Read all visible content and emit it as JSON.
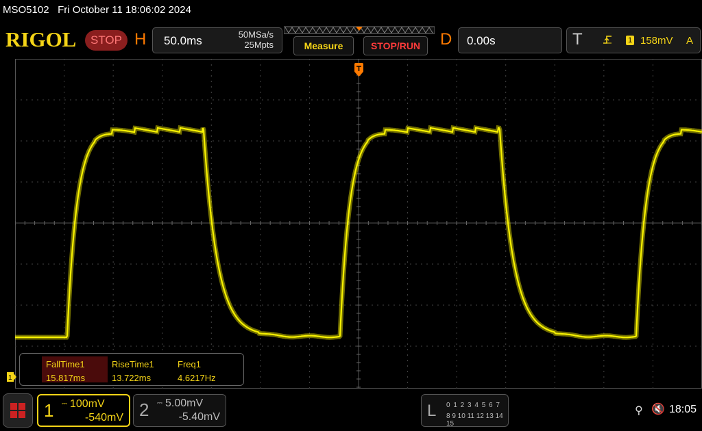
{
  "title_bar": {
    "model": "MSO5102",
    "datetime": "Fri October 11 18:06:02 2024"
  },
  "brand": {
    "logo": "RIGOL",
    "run_state": "STOP",
    "accent": "#f4d417"
  },
  "horizontal": {
    "letter": "H",
    "timebase": "50.0ms",
    "sample_rate": "50MSa/s",
    "memory_depth": "25Mpts"
  },
  "buttons": {
    "measure": "Measure",
    "stop_run": "STOP/RUN"
  },
  "delay": {
    "letter": "D",
    "value": "0.00s"
  },
  "trigger": {
    "letter": "T",
    "edge_icon": "rising-edge-icon",
    "channel": "1",
    "level": "158mV",
    "mode": "A"
  },
  "measurements": [
    {
      "label": "FallTime1",
      "value": "15.817ms"
    },
    {
      "label": "RiseTime1",
      "value": "13.722ms"
    },
    {
      "label": "Freq1",
      "value": "4.6217Hz"
    }
  ],
  "channels": [
    {
      "num": "1",
      "scale": "100mV",
      "offset": "-540mV",
      "color": "#f4d417"
    },
    {
      "num": "2",
      "scale": "5.00mV",
      "offset": "-5.40mV",
      "color": "#aaaaaa"
    }
  ],
  "logic": {
    "letter": "L",
    "row1": "0 1 2 3  4 5 6 7",
    "row2": "8 9 10 11 12 13 14 15"
  },
  "status": {
    "usb_icon": "usb-icon",
    "speaker_icon": "speaker-muted-icon",
    "time": "18:05"
  },
  "trace_color": "#f8f200"
}
